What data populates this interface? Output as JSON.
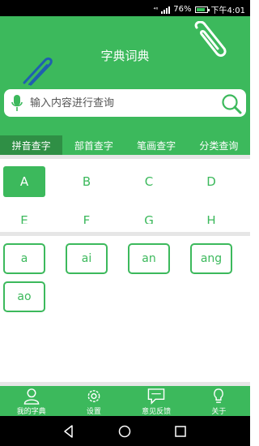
{
  "status_bar": {
    "signal_label": "⁴⁶",
    "battery": "76%",
    "time": "下午4:01"
  },
  "header": {
    "title": "字典词典"
  },
  "search": {
    "placeholder": "输入内容进行查询"
  },
  "tabs": [
    {
      "label": "拼音查字",
      "active": true
    },
    {
      "label": "部首查字",
      "active": false
    },
    {
      "label": "笔画查字",
      "active": false
    },
    {
      "label": "分类查询",
      "active": false
    }
  ],
  "letters": [
    "A",
    "B",
    "C",
    "D",
    "E",
    "F",
    "G",
    "H"
  ],
  "selected_letter": "A",
  "syllables": [
    "a",
    "ai",
    "an",
    "ang",
    "ao"
  ],
  "bottom_nav": [
    {
      "label": "我的字典",
      "icon": "person-icon"
    },
    {
      "label": "设置",
      "icon": "gear-icon"
    },
    {
      "label": "意见反馈",
      "icon": "chat-icon"
    },
    {
      "label": "关于",
      "icon": "lightbulb-icon"
    }
  ],
  "colors": {
    "primary": "#3cb95c",
    "tab_active": "#2f8f45",
    "divider": "#e6e6e6"
  }
}
